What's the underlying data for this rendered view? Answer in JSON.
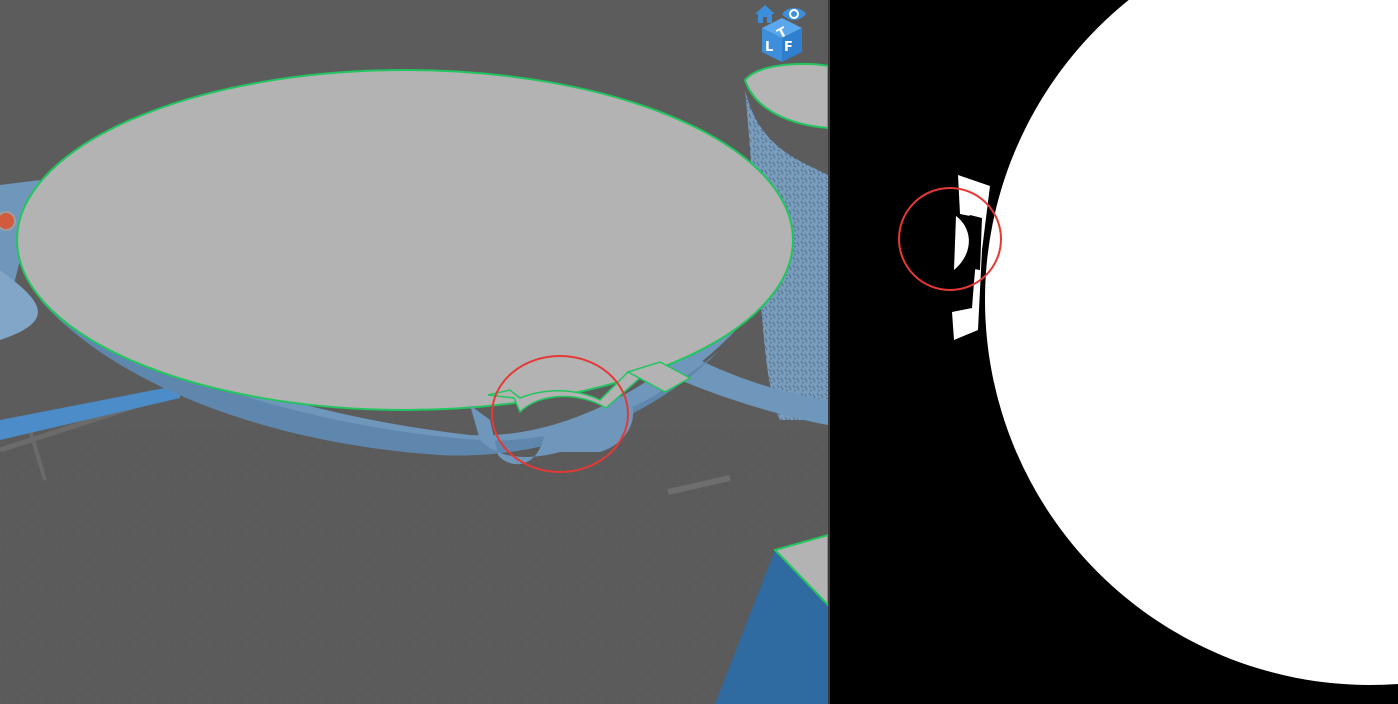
{
  "viewport": {
    "background": "#5a5a5a",
    "model_color": "#6f96bb",
    "surface_color": "#b3b3b3",
    "outline_color": "#22c55e",
    "highlight_color": "#e53935"
  },
  "nav_cube": {
    "top_label": "T",
    "left_label": "L",
    "front_label": "F",
    "home_icon": "home-icon",
    "view_icon": "eye-icon",
    "color": "#3d8fdc"
  },
  "slice_preview": {
    "background": "#000000",
    "fill": "#ffffff",
    "highlight_color": "#e53935"
  }
}
